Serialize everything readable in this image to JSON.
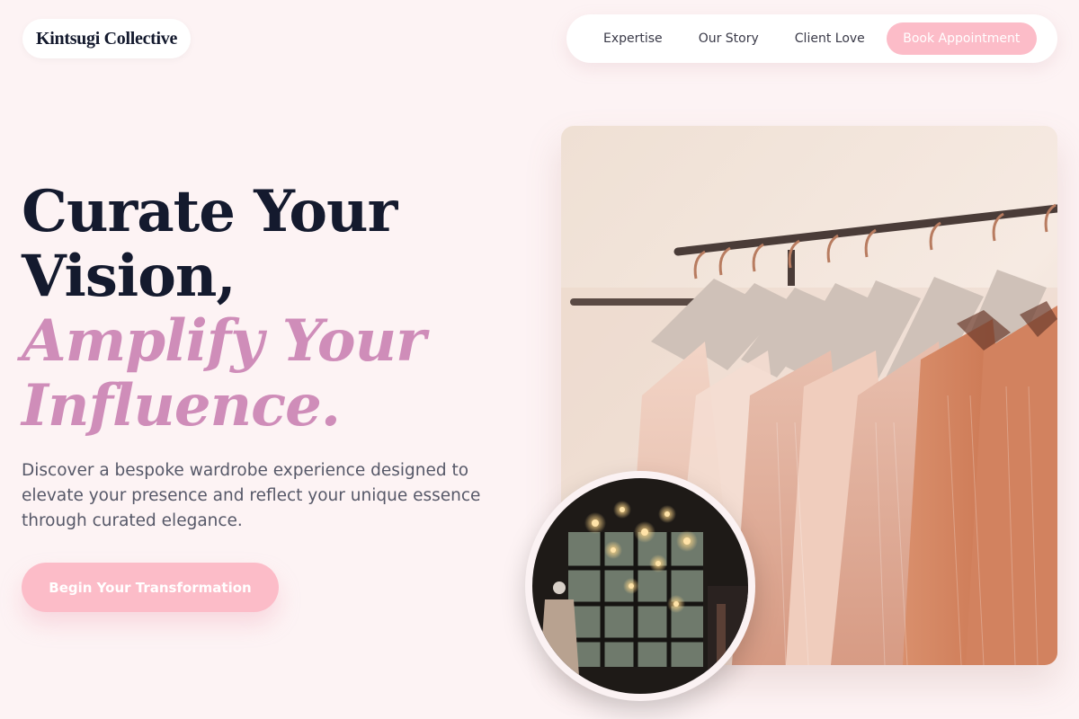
{
  "brand": {
    "name": "Kintsugi Collective"
  },
  "nav": {
    "links": [
      "Expertise",
      "Our Story",
      "Client Love"
    ],
    "cta": "Book Appointment"
  },
  "hero": {
    "headline_line1": "Curate Your",
    "headline_line2": "Vision,",
    "headline_accent1": "Amplify Your",
    "headline_accent2": "Influence.",
    "subtitle": "Discover a bespoke wardrobe experience designed to elevate your presence and reflect your unique essence through curated elegance.",
    "cta": "Begin Your Transformation"
  },
  "images": {
    "main": "clothing-rack-photo",
    "inset": "boutique-interior-photo"
  },
  "colors": {
    "background": "#fdf3f4",
    "accent_pink": "#fcbcc8",
    "accent_mauve": "#cf8db9",
    "heading": "#141a2e"
  }
}
